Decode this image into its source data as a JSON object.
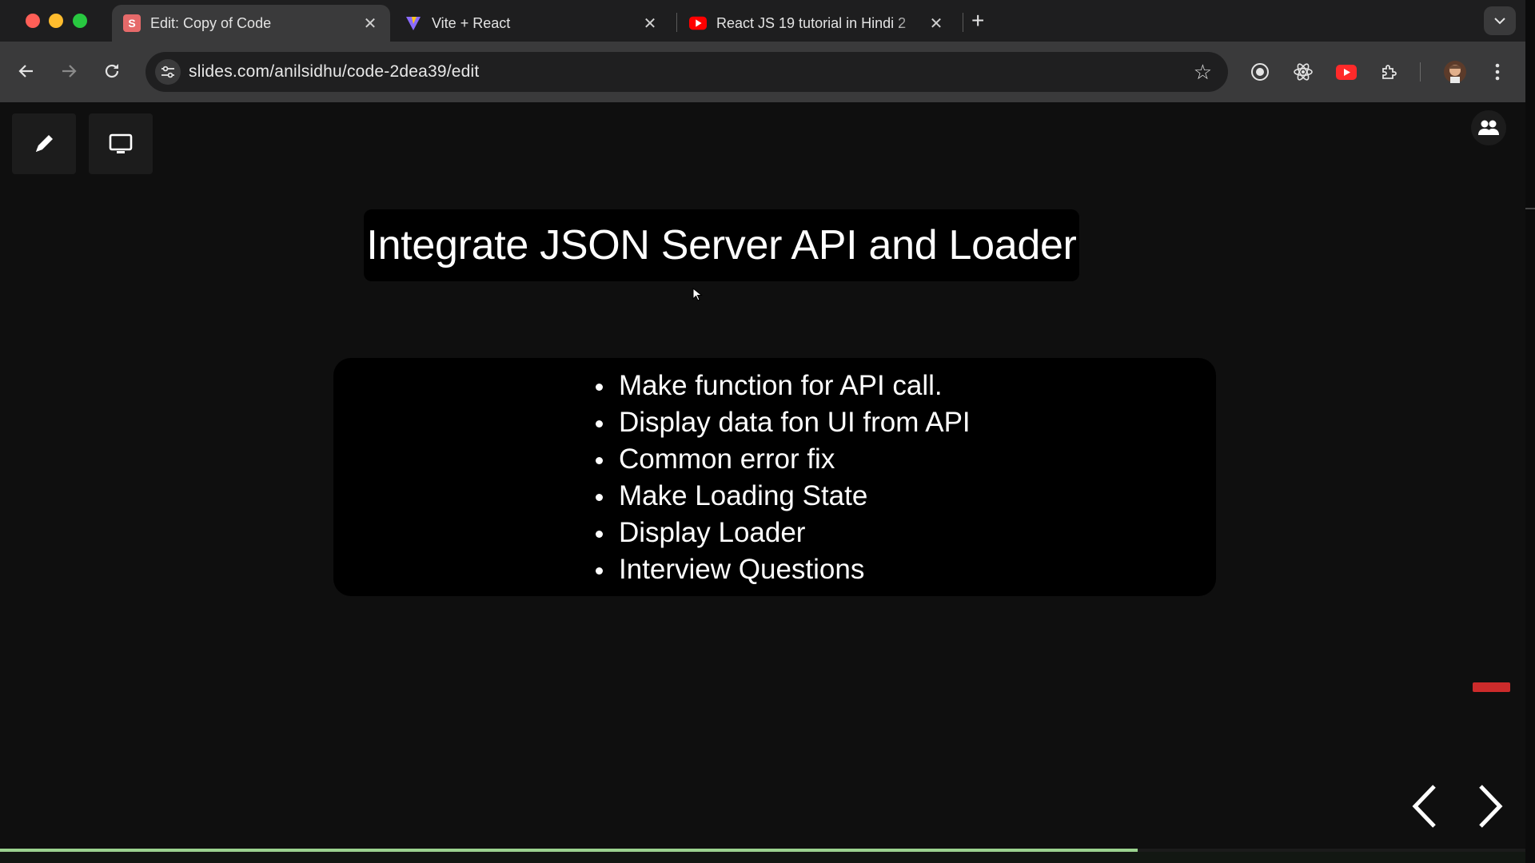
{
  "browser": {
    "tabs": [
      {
        "title": "Edit: Copy of Code",
        "favicon": "slides-icon",
        "favicon_letter": "S",
        "favicon_color": "#e66a6a",
        "active": true
      },
      {
        "title": "Vite + React",
        "favicon": "vite-icon",
        "active": false
      },
      {
        "title": "React JS 19 tutorial in Hindi 2",
        "favicon": "youtube-icon",
        "favicon_color": "#ff0000",
        "active": false
      }
    ],
    "new_tab_symbol": "+",
    "address": "slides.com/anilsidhu/code-2dea39/edit",
    "extensions": [
      "record-icon",
      "react-devtools-icon",
      "youtube-extension-icon",
      "puzzle-icon"
    ]
  },
  "slide": {
    "title": "Integrate JSON Server API and Loader",
    "bullets": [
      "Make function for API call.",
      "Display data fon UI from API",
      "Common error fix",
      "Make Loading State",
      "Display Loader",
      "Interview Questions"
    ]
  },
  "editor_tools": [
    "pen-icon",
    "present-icon"
  ],
  "progress": 0.746,
  "colors": {
    "accent": "#9bd38f",
    "background": "#0f0f0f",
    "box": "#000000"
  }
}
